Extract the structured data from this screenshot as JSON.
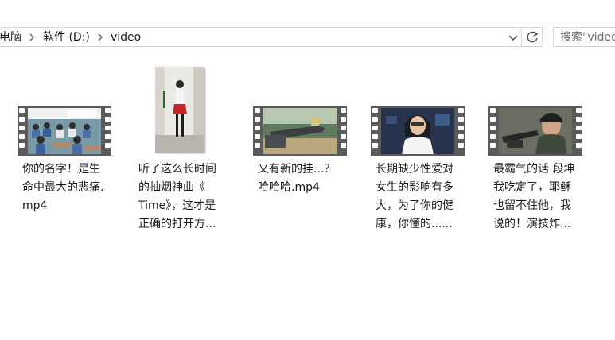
{
  "breadcrumb": {
    "items": [
      "电脑",
      "软件 (D:)",
      "video"
    ]
  },
  "search": {
    "placeholder": "搜索\"video\""
  },
  "files": [
    {
      "name": "你的名字！是生\n命中最大的悲痛.\nmp4",
      "thumb": "classroom"
    },
    {
      "name": "听了这么长时间\n的抽烟神曲《\nTime》，这才是\n正确的打开方...",
      "thumb": "dancer"
    },
    {
      "name": "又有新的挂...？\n哈哈哈.mp4",
      "thumb": "game"
    },
    {
      "name": "长期缺少性爱对\n女生的影响有多\n大，为了你的健\n康，你懂的......",
      "thumb": "woman"
    },
    {
      "name": "最霸气的话 段坤\n我吃定了，耶稣\n也留不住他，我\n说的！演技炸...",
      "thumb": "soldier"
    }
  ],
  "colors": {
    "film": "#5b5b5b",
    "border": "#d9d9d9",
    "text": "#1a1a1a"
  }
}
